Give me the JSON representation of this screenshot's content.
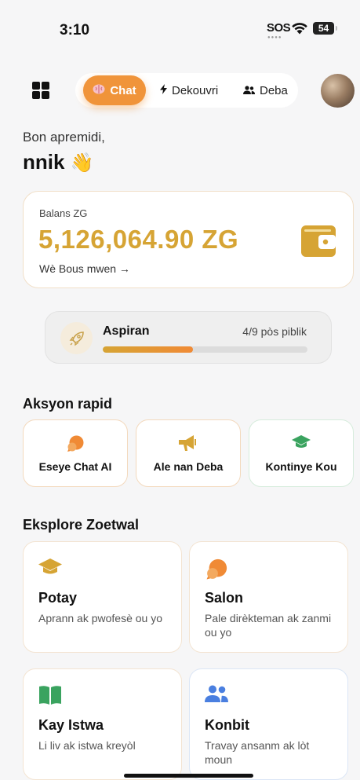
{
  "status_bar": {
    "time": "3:10",
    "sos": "SOS",
    "battery": "54"
  },
  "nav": {
    "tabs": [
      {
        "label": "Chat",
        "icon": "brain-icon",
        "active": true
      },
      {
        "label": "Dekouvri",
        "icon": "lightning-icon"
      },
      {
        "label": "Deba",
        "icon": "people-icon"
      }
    ],
    "accent": "#f0943a"
  },
  "greeting": {
    "line": "Bon apremidi,",
    "name": "nnik",
    "emoji": "👋"
  },
  "balance": {
    "label": "Balans ZG",
    "amount": "5,126,064.90 ZG",
    "link": "Wè Bous mwen →",
    "accent": "#d6a434"
  },
  "level": {
    "name": "Aspiran",
    "count": "4/9 pòs piblik",
    "progress": 0.44
  },
  "quick_actions": {
    "title": "Aksyon rapid",
    "items": [
      {
        "label": "Eseye Chat AI",
        "icon": "chat-bubble-icon"
      },
      {
        "label": "Ale nan Deba",
        "icon": "megaphone-icon"
      },
      {
        "label": "Kontinye Kou",
        "icon": "graduation-cap-icon"
      }
    ]
  },
  "explore": {
    "title": "Eksplore Zoetwal",
    "items": [
      {
        "title": "Potay",
        "desc": "Aprann ak pwofesè ou yo",
        "icon": "graduation-cap-icon"
      },
      {
        "title": "Salon",
        "desc": "Pale dirèkteman ak zanmi ou yo",
        "icon": "chat-bubble-icon"
      },
      {
        "title": "Kay Istwa",
        "desc": "Li liv ak istwa kreyòl",
        "icon": "book-icon"
      },
      {
        "title": "Konbit",
        "desc": "Travay ansanm ak lòt moun",
        "icon": "people-icon"
      }
    ]
  }
}
